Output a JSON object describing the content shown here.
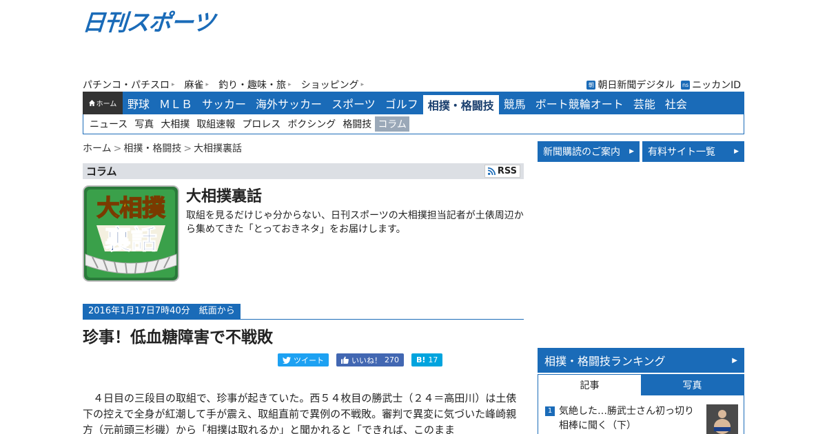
{
  "logo": {
    "text": "日刊スポーツ"
  },
  "top_links": [
    "パチンコ・パチスロ",
    "麻雀",
    "釣り・趣味・旅",
    "ショッピング"
  ],
  "partner_links": [
    {
      "badge": "朝",
      "label": "朝日新聞デジタル"
    },
    {
      "badge": "ns",
      "label": "ニッカンID"
    }
  ],
  "nav": {
    "home_label": "ホーム",
    "items": [
      "野球",
      "ＭＬＢ",
      "サッカー",
      "海外サッカー",
      "スポーツ",
      "ゴルフ",
      "相撲・格闘技",
      "競馬",
      "ボート競輪オート",
      "芸能",
      "社会"
    ],
    "active_index": 6
  },
  "subnav": {
    "items": [
      "ニュース",
      "写真",
      "大相撲",
      "取組速報",
      "プロレス",
      "ボクシング",
      "格闘技",
      "コラム"
    ],
    "active_index": 7
  },
  "breadcrumb": [
    "ホーム",
    "相撲・格闘技",
    "大相撲裏話"
  ],
  "column_bar": {
    "title": "コラム",
    "rss_label": "RSS"
  },
  "column": {
    "name": "大相撲裏話",
    "description": "取組を見るだけじゃ分からない、日刊スポーツの大相撲担当記者が土俵周辺から集めてきた「とっておきネタ」をお届けします。",
    "image_line1": "大相撲",
    "image_line2": "裏話"
  },
  "article": {
    "date": "2016年1月17日7時40分　紙面から",
    "headline": "珍事！低血糖障害で不戦敗",
    "body": "　４日目の三段目の取組で、珍事が起きていた。西５４枚目の勝武士（２４＝高田川）は土俵下の控えで全身が紅潮して手が震え、取組直前で異例の不戦敗。審判で異変に気づいた峰崎親方（元前頭三杉磯）から「相撲は取れるか」と聞かれると「できれば、このまま"
  },
  "social": {
    "tweet_label": "ツイート",
    "like_label": "いいね！",
    "like_count": "270",
    "hatena_label": "B!",
    "hatena_count": "17"
  },
  "sidebar": {
    "buttons": [
      "新聞購読のご案内",
      "有料サイト一覧"
    ],
    "ranking_title": "相撲・格闘技ランキング",
    "tabs": [
      "記事",
      "写真"
    ],
    "ranking_items": [
      {
        "rank": "1",
        "title": "気絶した…勝武士さん初っ切り相棒に聞く（下）"
      }
    ]
  },
  "colors": {
    "primary": "#1a6bb8",
    "home_bg": "#333333",
    "twitter": "#1da1f2",
    "facebook": "#4267b2",
    "hatena": "#00a4de"
  }
}
